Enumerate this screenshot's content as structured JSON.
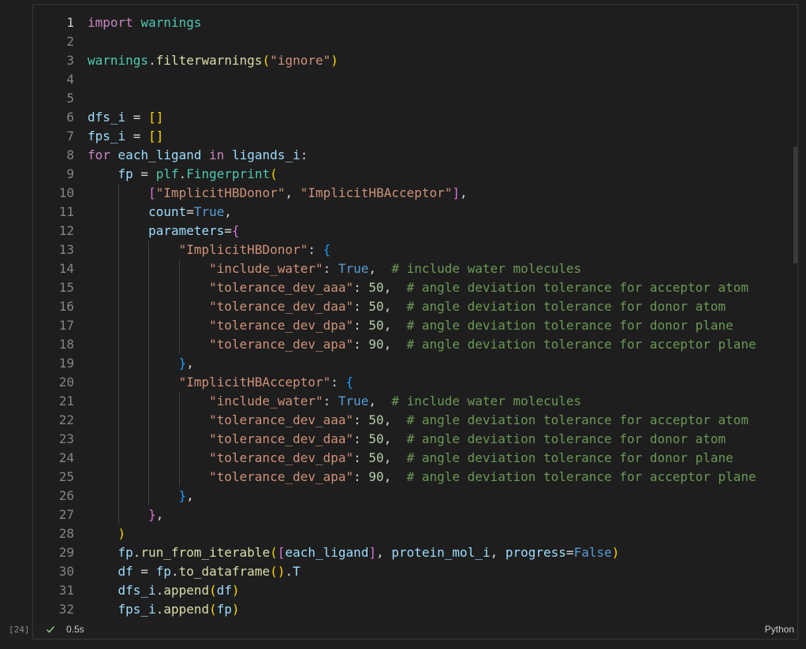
{
  "cell": {
    "execution_count": "[24]",
    "status_time": "0.5s",
    "language": "Python",
    "status_icon": "checkmark-icon",
    "colors": {
      "keyword": "#c586c0",
      "function": "#dcdcaa",
      "variable": "#9cdcfe",
      "string": "#ce9178",
      "number": "#b5cea8",
      "constant": "#569cd6",
      "comment": "#6a9955"
    }
  },
  "code": {
    "lines": [
      "import warnings",
      "",
      "warnings.filterwarnings(\"ignore\")",
      "",
      "",
      "dfs_i = []",
      "fps_i = []",
      "for each_ligand in ligands_i:",
      "    fp = plf.Fingerprint(",
      "        [\"ImplicitHBDonor\", \"ImplicitHBAcceptor\"],",
      "        count=True,",
      "        parameters={",
      "            \"ImplicitHBDonor\": {",
      "                \"include_water\": True,  # include water molecules",
      "                \"tolerance_dev_aaa\": 50,  # angle deviation tolerance for acceptor atom",
      "                \"tolerance_dev_daa\": 50,  # angle deviation tolerance for donor atom",
      "                \"tolerance_dev_dpa\": 50,  # angle deviation tolerance for donor plane",
      "                \"tolerance_dev_apa\": 90,  # angle deviation tolerance for acceptor plane",
      "            },",
      "            \"ImplicitHBAcceptor\": {",
      "                \"include_water\": True,  # include water molecules",
      "                \"tolerance_dev_aaa\": 50,  # angle deviation tolerance for acceptor atom",
      "                \"tolerance_dev_daa\": 50,  # angle deviation tolerance for donor atom",
      "                \"tolerance_dev_dpa\": 50,  # angle deviation tolerance for donor plane",
      "                \"tolerance_dev_apa\": 90,  # angle deviation tolerance for acceptor plane",
      "            },",
      "        },",
      "    )",
      "    fp.run_from_iterable([each_ligand], protein_mol_i, progress=False)",
      "    df = fp.to_dataframe().T",
      "    dfs_i.append(df)",
      "    fps_i.append(fp)"
    ]
  }
}
